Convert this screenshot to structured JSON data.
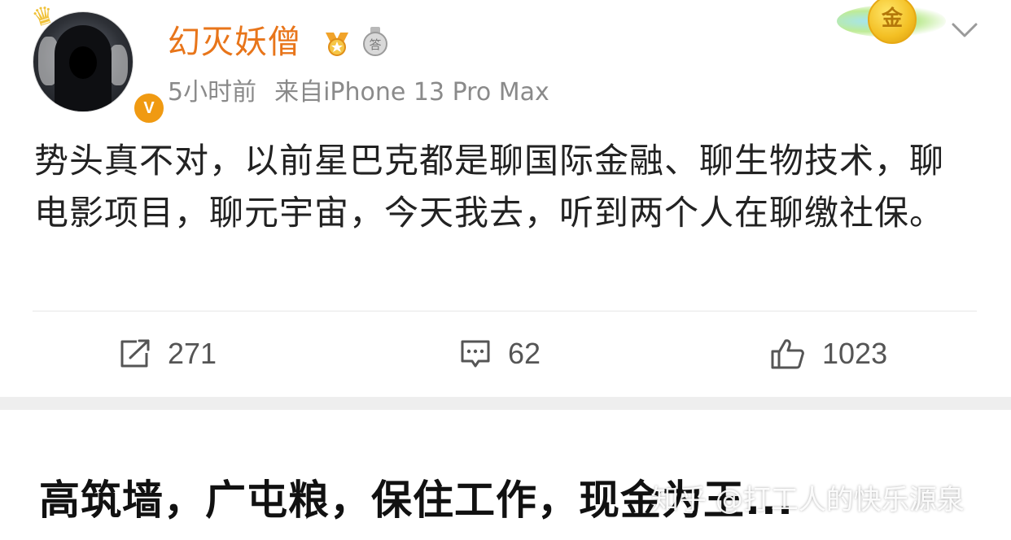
{
  "post": {
    "username": "幻灭妖僧",
    "verified_badge": "V",
    "timestamp": "5小时前",
    "source": "来自iPhone 13 Pro Max",
    "gold_badge_label": "金",
    "text": "势头真不对，以前星巴克都是聊国际金融、聊生物技术，聊电影项目，聊元宇宙，今天我去，听到两个人在聊缴社保。",
    "actions": {
      "repost_count": "271",
      "comment_count": "62",
      "like_count": "1023"
    },
    "icons": {
      "repost": "repost-icon",
      "comment": "comment-icon",
      "like": "thumbs-up-icon",
      "menu": "chevron-down-icon",
      "medal": "medal-icon",
      "rank": "rank-icon",
      "crown": "crown-icon"
    },
    "colors": {
      "username": "#e8751a",
      "meta": "#8a8a8a",
      "badge": "#f09a12"
    }
  },
  "caption": {
    "text": "高筑墙，广屯粮，保住工作，现金为王..."
  },
  "watermark": {
    "text": "知乎 @打工人的快乐源泉"
  }
}
